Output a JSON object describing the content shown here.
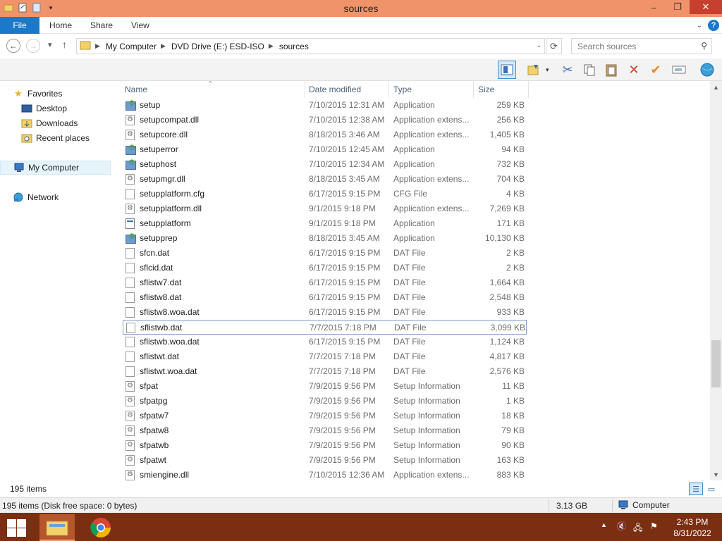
{
  "window": {
    "title": "sources",
    "controls": {
      "minimize": "–",
      "maximize": "❐",
      "close": "✕"
    }
  },
  "ribbon": {
    "tabs": [
      "File",
      "Home",
      "Share",
      "View"
    ],
    "help": "?"
  },
  "address": {
    "crumbs": [
      "My Computer",
      "DVD Drive (E:) ESD-ISO",
      "sources"
    ],
    "search_placeholder": "Search sources"
  },
  "nav": {
    "favorites": "Favorites",
    "desktop": "Desktop",
    "downloads": "Downloads",
    "recent": "Recent places",
    "computer": "My Computer",
    "network": "Network"
  },
  "columns": {
    "name": "Name",
    "date": "Date modified",
    "type": "Type",
    "size": "Size"
  },
  "files": [
    {
      "name": "setup",
      "date": "7/10/2015 12:31 AM",
      "type": "Application",
      "size": "259 KB",
      "icon": "app"
    },
    {
      "name": "setupcompat.dll",
      "date": "7/10/2015 12:38 AM",
      "type": "Application extens...",
      "size": "256 KB",
      "icon": "dll"
    },
    {
      "name": "setupcore.dll",
      "date": "8/18/2015 3:46 AM",
      "type": "Application extens...",
      "size": "1,405 KB",
      "icon": "dll"
    },
    {
      "name": "setuperror",
      "date": "7/10/2015 12:45 AM",
      "type": "Application",
      "size": "94 KB",
      "icon": "app"
    },
    {
      "name": "setuphost",
      "date": "7/10/2015 12:34 AM",
      "type": "Application",
      "size": "732 KB",
      "icon": "app"
    },
    {
      "name": "setupmgr.dll",
      "date": "8/18/2015 3:45 AM",
      "type": "Application extens...",
      "size": "704 KB",
      "icon": "dll"
    },
    {
      "name": "setupplatform.cfg",
      "date": "6/17/2015 9:15 PM",
      "type": "CFG File",
      "size": "4 KB",
      "icon": "doc"
    },
    {
      "name": "setupplatform.dll",
      "date": "9/1/2015 9:18 PM",
      "type": "Application extens...",
      "size": "7,269 KB",
      "icon": "dll"
    },
    {
      "name": "setupplatform",
      "date": "9/1/2015 9:18 PM",
      "type": "Application",
      "size": "171 KB",
      "icon": "win"
    },
    {
      "name": "setupprep",
      "date": "8/18/2015 3:45 AM",
      "type": "Application",
      "size": "10,130 KB",
      "icon": "app"
    },
    {
      "name": "sfcn.dat",
      "date": "6/17/2015 9:15 PM",
      "type": "DAT File",
      "size": "2 KB",
      "icon": "doc"
    },
    {
      "name": "sflcid.dat",
      "date": "6/17/2015 9:15 PM",
      "type": "DAT File",
      "size": "2 KB",
      "icon": "doc"
    },
    {
      "name": "sflistw7.dat",
      "date": "6/17/2015 9:15 PM",
      "type": "DAT File",
      "size": "1,664 KB",
      "icon": "doc"
    },
    {
      "name": "sflistw8.dat",
      "date": "6/17/2015 9:15 PM",
      "type": "DAT File",
      "size": "2,548 KB",
      "icon": "doc"
    },
    {
      "name": "sflistw8.woa.dat",
      "date": "6/17/2015 9:15 PM",
      "type": "DAT File",
      "size": "933 KB",
      "icon": "doc"
    },
    {
      "name": "sflistwb.dat",
      "date": "7/7/2015 7:18 PM",
      "type": "DAT File",
      "size": "3,099 KB",
      "icon": "doc",
      "focused": true
    },
    {
      "name": "sflistwb.woa.dat",
      "date": "6/17/2015 9:15 PM",
      "type": "DAT File",
      "size": "1,124 KB",
      "icon": "doc"
    },
    {
      "name": "sflistwt.dat",
      "date": "7/7/2015 7:18 PM",
      "type": "DAT File",
      "size": "4,817 KB",
      "icon": "doc"
    },
    {
      "name": "sflistwt.woa.dat",
      "date": "7/7/2015 7:18 PM",
      "type": "DAT File",
      "size": "2,576 KB",
      "icon": "doc"
    },
    {
      "name": "sfpat",
      "date": "7/9/2015 9:56 PM",
      "type": "Setup Information",
      "size": "11 KB",
      "icon": "inf"
    },
    {
      "name": "sfpatpg",
      "date": "7/9/2015 9:56 PM",
      "type": "Setup Information",
      "size": "1 KB",
      "icon": "inf"
    },
    {
      "name": "sfpatw7",
      "date": "7/9/2015 9:56 PM",
      "type": "Setup Information",
      "size": "18 KB",
      "icon": "inf"
    },
    {
      "name": "sfpatw8",
      "date": "7/9/2015 9:56 PM",
      "type": "Setup Information",
      "size": "79 KB",
      "icon": "inf"
    },
    {
      "name": "sfpatwb",
      "date": "7/9/2015 9:56 PM",
      "type": "Setup Information",
      "size": "90 KB",
      "icon": "inf"
    },
    {
      "name": "sfpatwt",
      "date": "7/9/2015 9:56 PM",
      "type": "Setup Information",
      "size": "163 KB",
      "icon": "inf"
    },
    {
      "name": "smiengine.dll",
      "date": "7/10/2015 12:36 AM",
      "type": "Application extens...",
      "size": "883 KB",
      "icon": "dll"
    }
  ],
  "status": {
    "item_count": "195 items",
    "detail": "195 items (Disk free space: 0 bytes)",
    "size": "3.13 GB",
    "location": "Computer"
  },
  "clock": {
    "time": "2:43 PM",
    "date": "8/31/2022"
  },
  "colors": {
    "titlebar": "#f0936a",
    "file_tab": "#1979ca",
    "taskbar": "#7a2f12",
    "close": "#c7402d"
  }
}
